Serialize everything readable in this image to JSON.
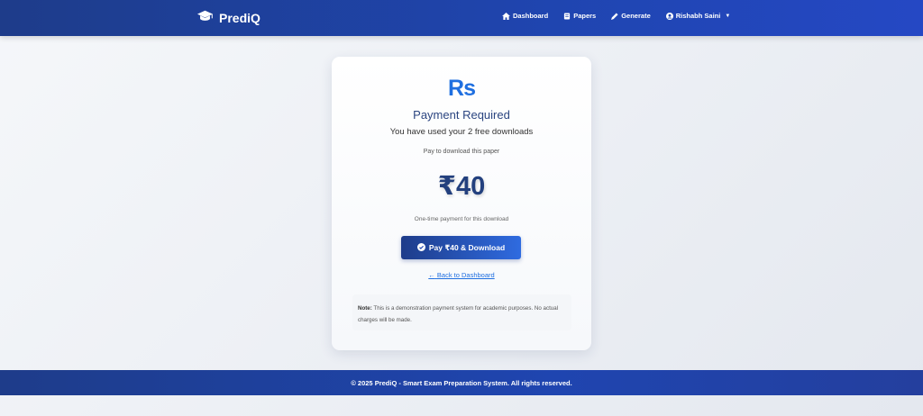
{
  "navbar": {
    "brand": "PrediQ",
    "links": [
      {
        "label": "Dashboard",
        "icon": "home-icon"
      },
      {
        "label": "Papers",
        "icon": "book-icon"
      },
      {
        "label": "Generate",
        "icon": "pencil-icon"
      }
    ],
    "user": {
      "label": "Rishabh Saini",
      "icon": "user-circle-icon"
    }
  },
  "payment": {
    "currency_icon": "Rs",
    "title": "Payment Required",
    "subtitle": "You have used your 2 free downloads",
    "prompt": "Pay to download this paper",
    "price": "₹40",
    "price_note": "One-time payment for this download",
    "pay_button": "Pay ₹40 & Download",
    "back_link": "Back to Dashboard",
    "note_label": "Note:",
    "note_text": " This is a demonstration payment system for academic purposes. No actual charges will be made."
  },
  "footer": {
    "text": "© 2025 PrediQ - Smart Exam Preparation System. All rights reserved."
  },
  "colors": {
    "primary": "#1e3c8a",
    "accent": "#1f6fe0",
    "price": "#23407e"
  }
}
